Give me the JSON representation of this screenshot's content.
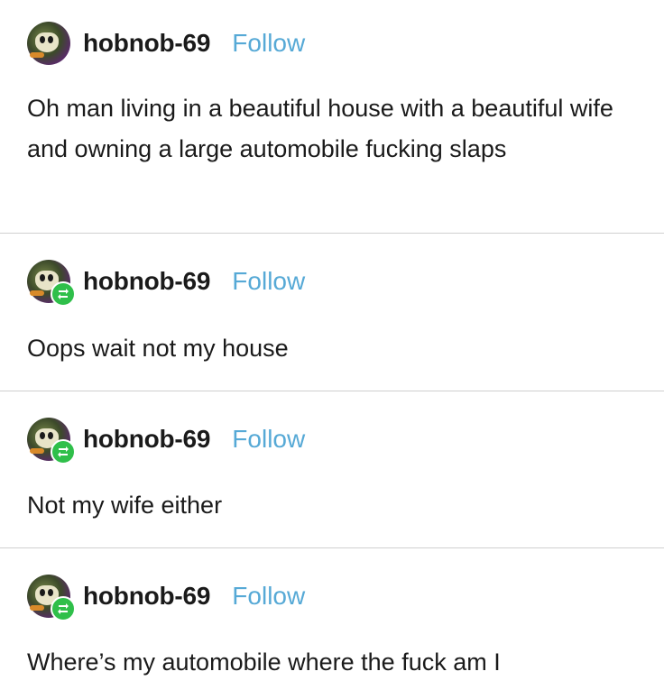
{
  "posts": [
    {
      "username": "hobnob-69",
      "follow_label": "Follow",
      "text": "Oh man living in a beautiful house with a beautiful wife and owning a large automobile fucking slaps",
      "reblog": false
    },
    {
      "username": "hobnob-69",
      "follow_label": "Follow",
      "text": "Oops wait not my house",
      "reblog": true
    },
    {
      "username": "hobnob-69",
      "follow_label": "Follow",
      "text": "Not my wife either",
      "reblog": true
    },
    {
      "username": "hobnob-69",
      "follow_label": "Follow",
      "text": "Where’s my automobile where the fuck am I",
      "reblog": true
    }
  ],
  "colors": {
    "follow": "#56a9d6",
    "reblog_badge": "#2fbf4a",
    "divider": "#cfcfcf"
  },
  "icons": {
    "reblog": "reblog-icon",
    "avatar": "avatar"
  }
}
